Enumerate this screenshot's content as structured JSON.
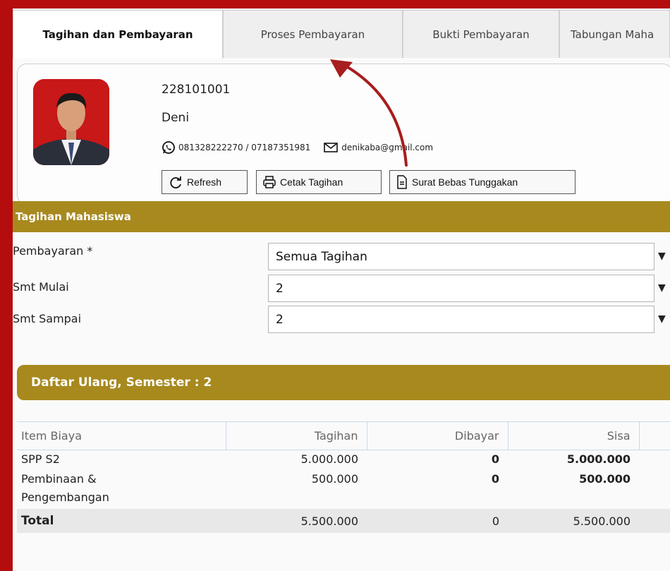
{
  "tabs": [
    "Tagihan dan Pembayaran",
    "Proses Pembayaran",
    "Bukti Pembayaran",
    "Tabungan Maha"
  ],
  "profile": {
    "nim": "228101001",
    "name": "Deni",
    "phone": "081328222270 / 07187351981",
    "email": "denikaba@gmail.com"
  },
  "buttons": {
    "refresh": "Refresh",
    "print": "Cetak Tagihan",
    "letter": "Surat Bebas Tunggakan"
  },
  "section": {
    "title": "Tagihan Mahasiswa"
  },
  "filters": [
    {
      "label": "Pembayaran *",
      "value": "Semua Tagihan"
    },
    {
      "label": "Smt Mulai",
      "value": "2"
    },
    {
      "label": "Smt Sampai",
      "value": "2"
    }
  ],
  "group": {
    "title": "Daftar Ulang, Semester : 2"
  },
  "table": {
    "headers": [
      "Item Biaya",
      "Tagihan",
      "Dibayar",
      "Sisa"
    ],
    "rows": [
      {
        "item": "SPP S2",
        "tagihan": "5.000.000",
        "dibayar": "0",
        "sisa": "5.000.000"
      },
      {
        "item_line1": "Pembinaan &",
        "item_line2": "Pengembangan",
        "tagihan": "500.000",
        "dibayar": "0",
        "sisa": "500.000"
      }
    ],
    "total": {
      "label": "Total",
      "tagihan": "5.500.000",
      "dibayar": "0",
      "sisa": "5.500.000"
    }
  },
  "colors": {
    "frame": "#b50d0d",
    "gold": "#a7891e",
    "arrow": "#a81d1d"
  }
}
